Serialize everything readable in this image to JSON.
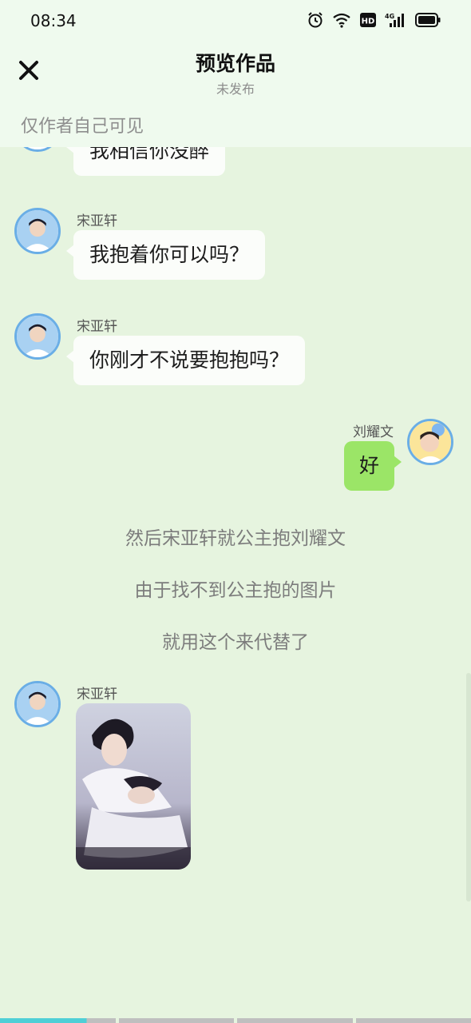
{
  "status": {
    "time": "08:34",
    "network_label": "HD",
    "signal_label": "4G"
  },
  "header": {
    "title": "预览作品",
    "subtitle": "未发布",
    "visibility_note": "仅作者自己可见"
  },
  "messages": [
    {
      "text": "我相信你没醉"
    },
    {
      "sender": "宋亚轩",
      "text": "我抱着你可以吗？"
    },
    {
      "sender": "宋亚轩",
      "text": "你刚才不说要抱抱吗？"
    },
    {
      "sender": "刘耀文",
      "text": "好"
    }
  ],
  "narration": [
    "然后宋亚轩就公主抱刘耀文",
    "由于找不到公主抱的图片",
    "就用这个来代替了"
  ],
  "image_message": {
    "sender": "宋亚轩"
  },
  "colors": {
    "background": "#e6f4df",
    "right_bubble": "#9be567",
    "avatar_border": "#6aaee6",
    "progress_active": "#4fcfd6"
  },
  "progress": {
    "segments": 4,
    "active_index": 0,
    "active_fill": 0.75
  }
}
